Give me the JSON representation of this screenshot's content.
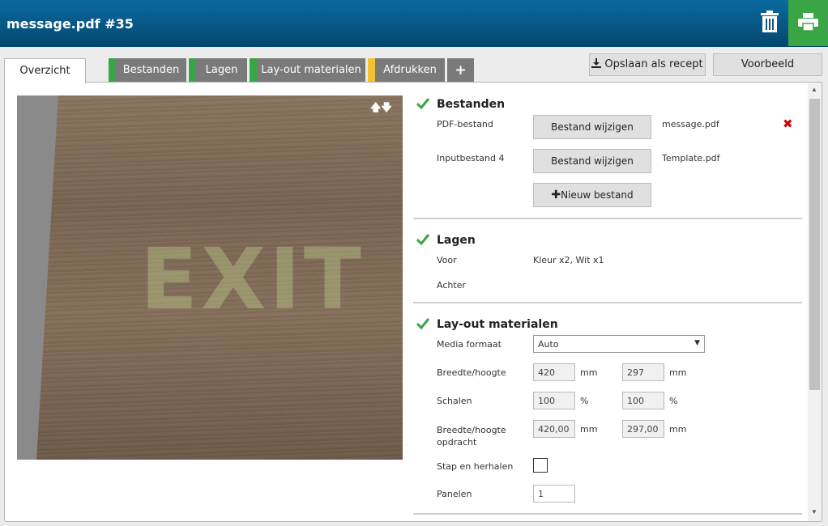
{
  "window": {
    "title": "message.pdf #35"
  },
  "tabs": [
    {
      "label": "Overzicht"
    },
    {
      "label": "Bestanden",
      "stripe": "#3aa545"
    },
    {
      "label": "Lagen",
      "stripe": "#3aa545"
    },
    {
      "label": "Lay-out materialen",
      "stripe": "#3aa545"
    },
    {
      "label": "Afdrukken",
      "stripe": "#f2c230"
    },
    {
      "label": "+"
    }
  ],
  "header_buttons": {
    "save_recipe": "Opslaan als recept",
    "preview": "Voorbeeld"
  },
  "preview": {
    "sign_text": "EXIT",
    "arrows": "🡅🡇"
  },
  "sections": {
    "bestanden": {
      "title": "Bestanden",
      "rows": [
        {
          "label": "PDF-bestand",
          "button": "Bestand wijzigen",
          "file": "message.pdf"
        },
        {
          "label": "Inputbestand 4",
          "button": "Bestand wijzigen",
          "file": "Template.pdf"
        }
      ],
      "new_file": "Nieuw bestand"
    },
    "lagen": {
      "title": "Lagen",
      "front_label": "Voor",
      "front_value": "Kleur x2, Wit x1",
      "back_label": "Achter"
    },
    "layout": {
      "title": "Lay-out materialen",
      "media_label": "Media formaat",
      "media_value": "Auto",
      "size_label": "Breedte/hoogte",
      "width": "420",
      "height": "297",
      "unit_mm": "mm",
      "scale_label": "Schalen",
      "scale_w": "100",
      "scale_h": "100",
      "unit_pct": "%",
      "job_size_label": "Breedte/hoogte opdracht",
      "job_w": "420,00",
      "job_h": "297,00",
      "step_label": "Stap en herhalen",
      "panels_label": "Panelen",
      "panels_value": "1"
    }
  },
  "colors": {
    "accent_green": "#3aa545",
    "title_blue": "#04476e",
    "warning_yellow": "#f2c230",
    "error_red": "#d40000"
  }
}
